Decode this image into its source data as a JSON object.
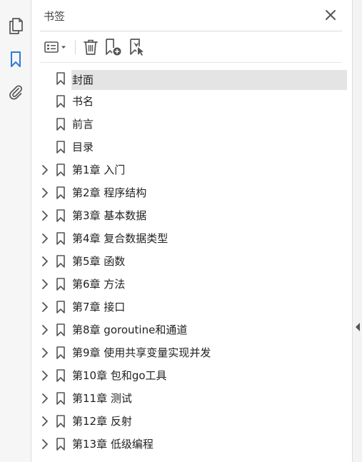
{
  "panel": {
    "title": "书签"
  },
  "icons": {
    "rail": [
      "pages-icon",
      "bookmark-icon",
      "attachment-icon"
    ],
    "toolbar": [
      "options-menu-icon",
      "delete-icon",
      "new-bookmark-icon",
      "bookmark-from-selection-icon"
    ],
    "close": "close-icon"
  },
  "colors": {
    "accent": "#2d7bd6",
    "icon_gray": "#555555",
    "selected_row": "#e4e4e4",
    "text": "#222222"
  },
  "bookmarks": [
    {
      "label": "封面",
      "expandable": false,
      "selected": true
    },
    {
      "label": "书名",
      "expandable": false,
      "selected": false
    },
    {
      "label": "前言",
      "expandable": false,
      "selected": false
    },
    {
      "label": "目录",
      "expandable": false,
      "selected": false
    },
    {
      "label": "第1章 入门",
      "expandable": true,
      "selected": false
    },
    {
      "label": "第2章 程序结构",
      "expandable": true,
      "selected": false
    },
    {
      "label": "第3章 基本数据",
      "expandable": true,
      "selected": false
    },
    {
      "label": "第4章 复合数据类型",
      "expandable": true,
      "selected": false
    },
    {
      "label": "第5章 函数",
      "expandable": true,
      "selected": false
    },
    {
      "label": "第6章 方法",
      "expandable": true,
      "selected": false
    },
    {
      "label": "第7章 接口",
      "expandable": true,
      "selected": false
    },
    {
      "label": "第8章 goroutine和通道",
      "expandable": true,
      "selected": false
    },
    {
      "label": "第9章 使用共享变量实现并发",
      "expandable": true,
      "selected": false
    },
    {
      "label": "第10章 包和go工具",
      "expandable": true,
      "selected": false
    },
    {
      "label": "第11章 测试",
      "expandable": true,
      "selected": false
    },
    {
      "label": "第12章 反射",
      "expandable": true,
      "selected": false
    },
    {
      "label": "第13章 低级编程",
      "expandable": true,
      "selected": false
    }
  ]
}
